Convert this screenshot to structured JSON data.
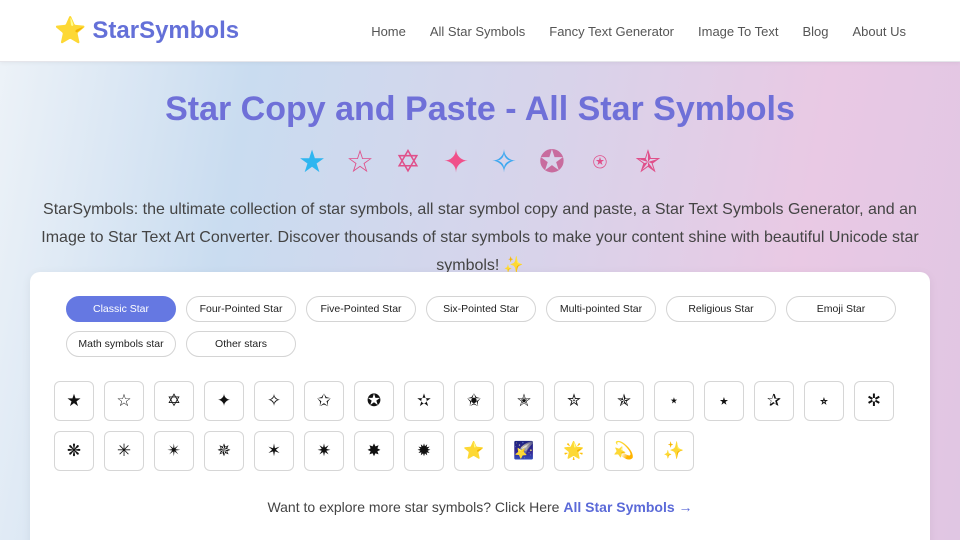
{
  "header": {
    "logo_icon": "⭐",
    "logo_text": "StarSymbols",
    "nav": [
      "Home",
      "All Star Symbols",
      "Fancy Text Generator",
      "Image To Text",
      "Blog",
      "About Us"
    ]
  },
  "hero": {
    "title": "Star Copy and Paste - All Star Symbols",
    "deco_stars": [
      {
        "char": "★",
        "color": "#2fb6f0"
      },
      {
        "char": "☆",
        "color": "#e0508a"
      },
      {
        "char": "✡",
        "color": "#e0508a"
      },
      {
        "char": "✦",
        "color": "#f0508a"
      },
      {
        "char": "✧",
        "color": "#3ea8f0"
      },
      {
        "char": "✪",
        "color": "#c86c9e"
      },
      {
        "char": "⍟",
        "color": "#e0508a"
      },
      {
        "char": "✯",
        "color": "#e0508a"
      }
    ],
    "intro": "StarSymbols: the ultimate collection of star symbols, all star symbol copy and paste, a Star Text Symbols Generator, and an Image to Star Text Art Converter. Discover thousands of star symbols to make your content shine with beautiful Unicode star symbols! ✨"
  },
  "categories": [
    {
      "label": "Classic Star",
      "active": true
    },
    {
      "label": "Four-Pointed Star",
      "active": false
    },
    {
      "label": "Five-Pointed Star",
      "active": false
    },
    {
      "label": "Six-Pointed Star",
      "active": false
    },
    {
      "label": "Multi-pointed Star",
      "active": false
    },
    {
      "label": "Religious Star",
      "active": false
    },
    {
      "label": "Emoji Star",
      "active": false
    },
    {
      "label": "Math symbols star",
      "active": false
    },
    {
      "label": "Other stars",
      "active": false
    }
  ],
  "symbols": [
    "★",
    "☆",
    "✡",
    "✦",
    "✧",
    "✩",
    "✪",
    "✫",
    "✬",
    "✭",
    "✮",
    "✯",
    "⋆",
    "⭑",
    "✰",
    "⭒",
    "✲",
    "❋",
    "✳",
    "✴",
    "✵",
    "✶",
    "✷",
    "✸",
    "✹",
    "⭐",
    "🌠",
    "🌟",
    "💫",
    "✨"
  ],
  "more": {
    "prefix": "Want to explore more star symbols? Click Here ",
    "link": "All Star Symbols →"
  }
}
